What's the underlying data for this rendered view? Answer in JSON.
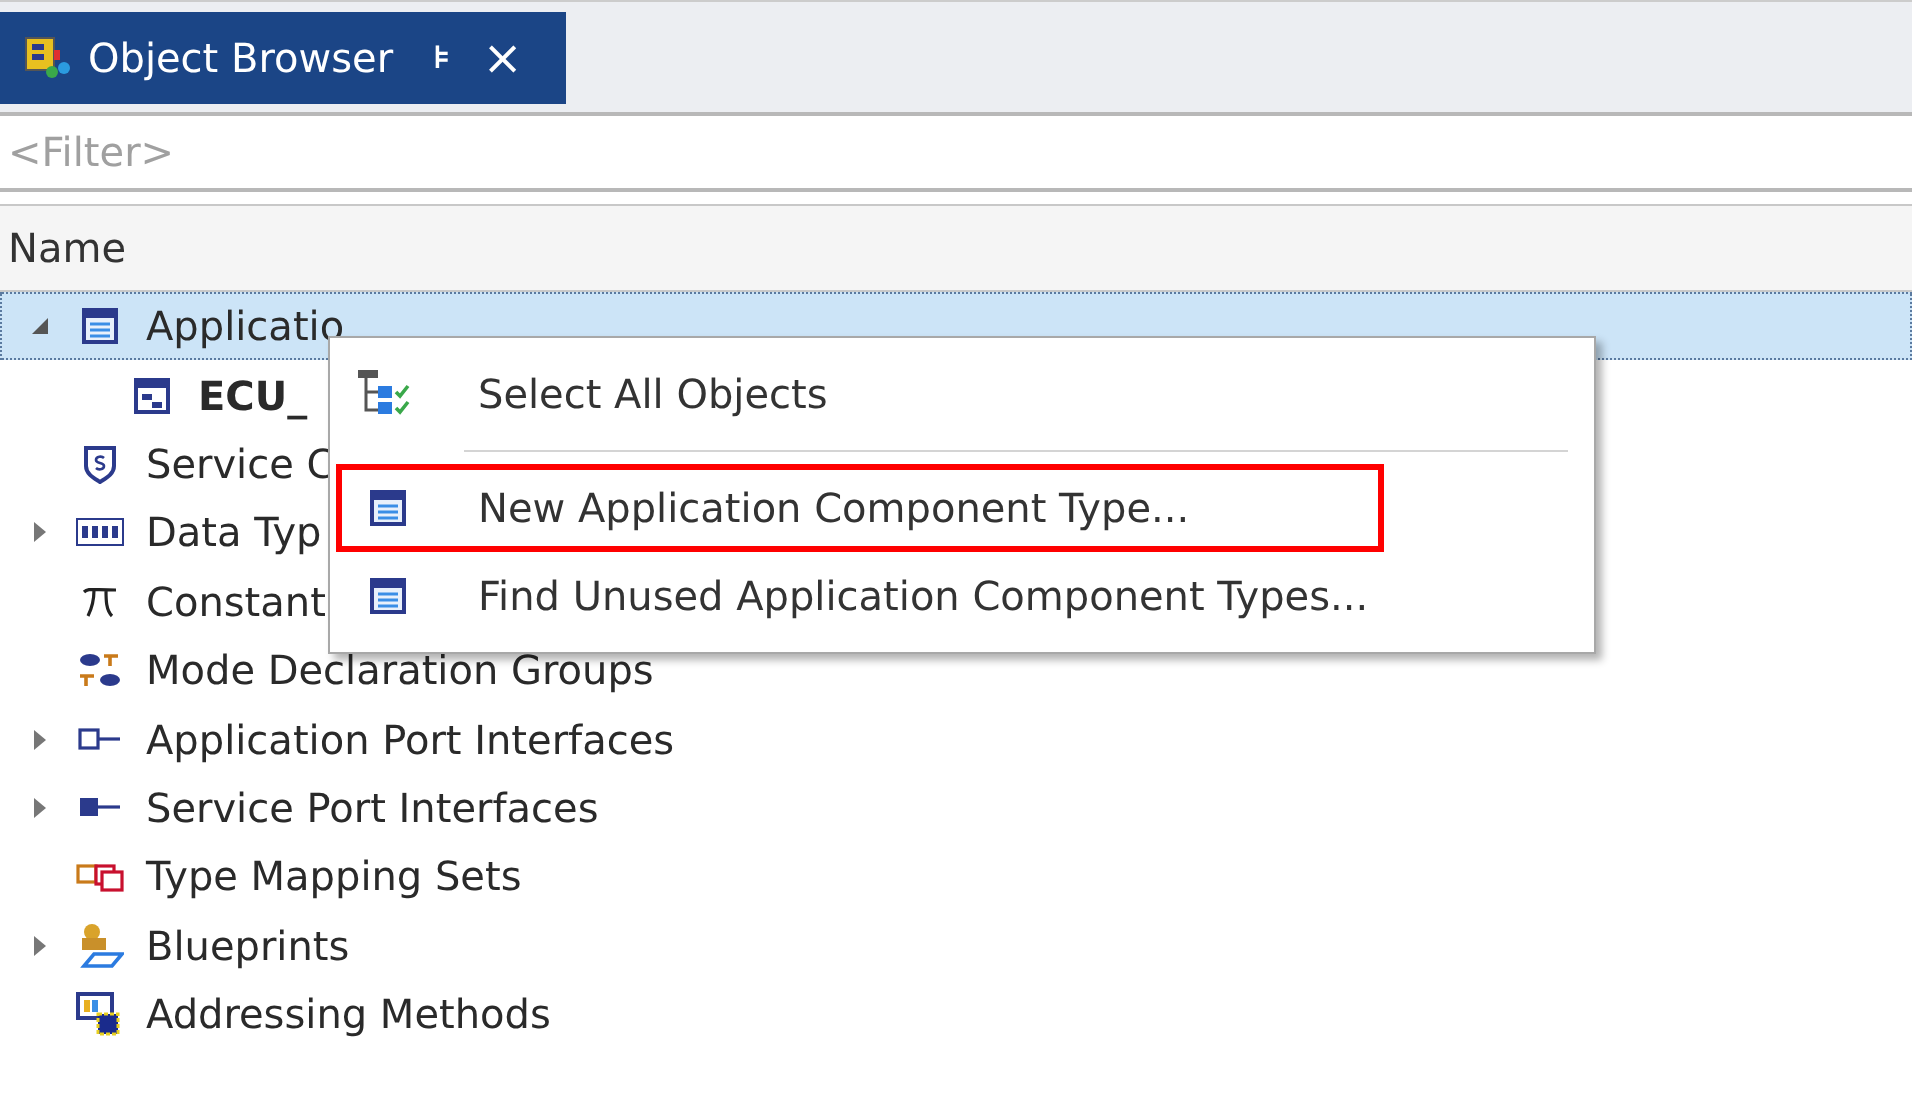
{
  "tab": {
    "title": "Object Browser",
    "pin": "⊧",
    "close": "×",
    "selected": true
  },
  "filter": {
    "placeholder": "<Filter>"
  },
  "column_header": {
    "label": "Name"
  },
  "tree": [
    {
      "label": "Applicatio",
      "expanded": true,
      "selected": true,
      "children": [
        {
          "label": "ECU_",
          "selected": false,
          "bold": true
        }
      ]
    },
    {
      "label": "Service C",
      "selected": false
    },
    {
      "label": "Data Typ",
      "expanded": false,
      "selected": false
    },
    {
      "label": "Constant",
      "selected": false
    },
    {
      "label": "Mode Declaration Groups",
      "selected": false
    },
    {
      "label": "Application Port Interfaces",
      "expanded": false,
      "selected": false
    },
    {
      "label": "Service Port Interfaces",
      "expanded": false,
      "selected": false
    },
    {
      "label": "Type Mapping Sets",
      "selected": false
    },
    {
      "label": "Blueprints",
      "expanded": false,
      "selected": false
    },
    {
      "label": "Addressing Methods",
      "selected": false
    }
  ],
  "context_menu": {
    "items": [
      {
        "label": "Select All Objects",
        "highlighted": false
      },
      {
        "kind": "separator"
      },
      {
        "label": "New Application Component Type...",
        "highlighted": true
      },
      {
        "label": "Find Unused Application Component Types...",
        "highlighted": false
      }
    ]
  }
}
